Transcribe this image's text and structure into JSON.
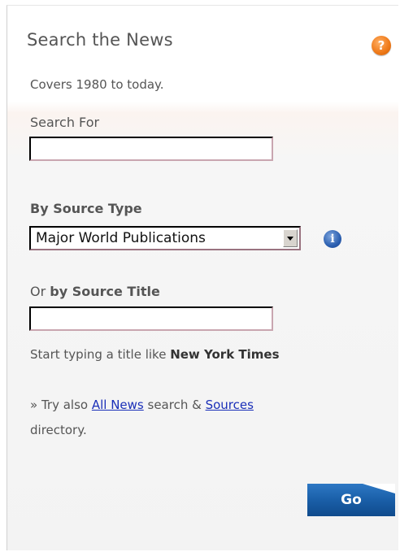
{
  "widget": {
    "title": "Search the News",
    "subtitle": "Covers 1980 to today."
  },
  "search_for": {
    "label": "Search For",
    "value": ""
  },
  "source_type": {
    "label": "By Source Type",
    "selected": "Major World Publications"
  },
  "source_title": {
    "label_prefix": "Or ",
    "label_bold": "by Source Title",
    "value": "",
    "hint_prefix": "Start typing a title like ",
    "hint_example": "New York Times"
  },
  "try_also": {
    "prefix": "» Try also ",
    "all_news_link": "All News",
    "middle": " search & ",
    "sources_link": "Sources",
    "suffix": "directory."
  },
  "go_button": {
    "label": "Go"
  },
  "icons": {
    "help": "question-mark",
    "info": "info-i"
  },
  "colors": {
    "link": "#1a2fb8",
    "help_icon": "#f07c1c",
    "info_icon": "#2b5fb0",
    "go_button": "#1a5fa8"
  }
}
